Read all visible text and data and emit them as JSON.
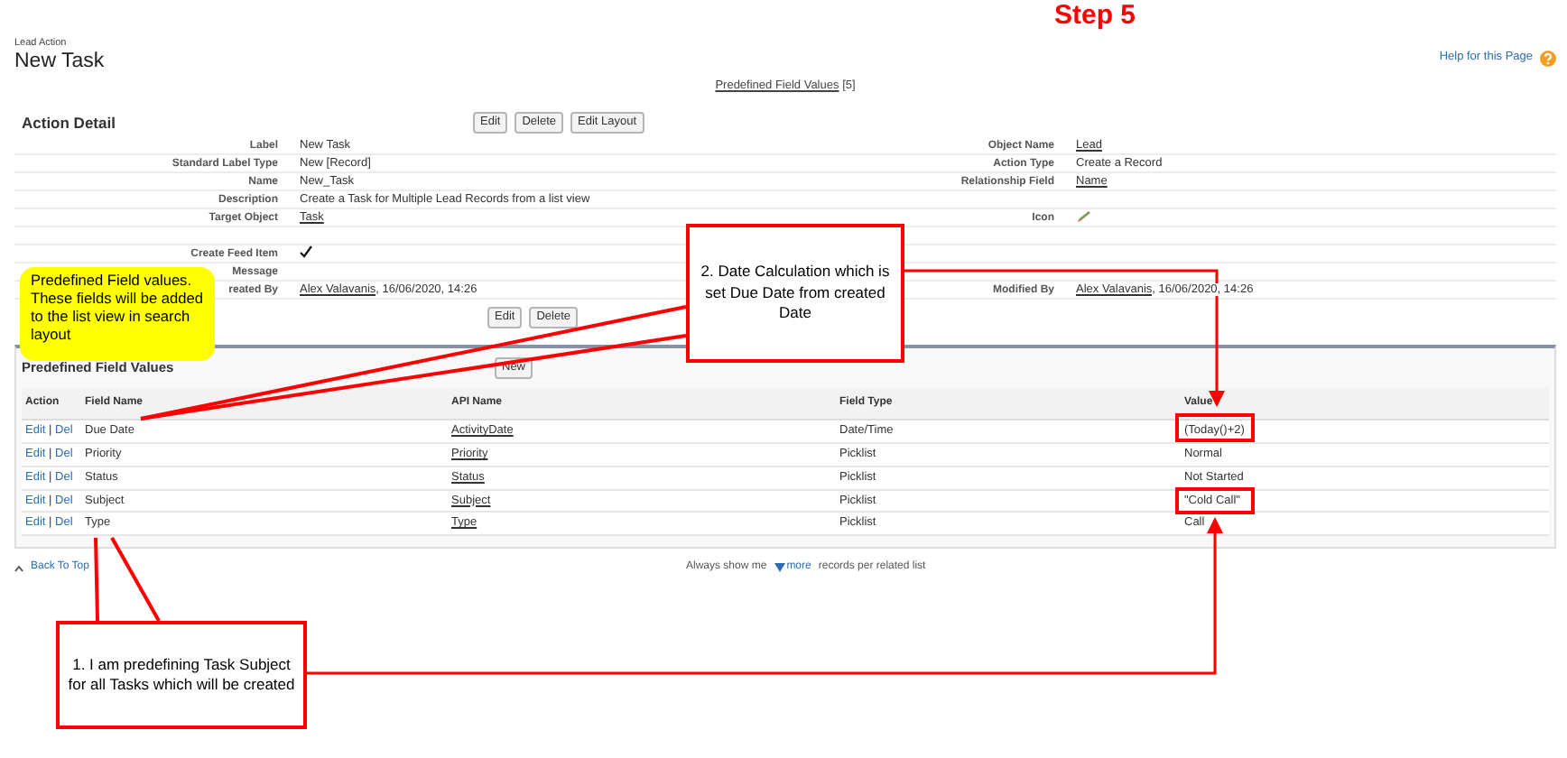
{
  "step_title": "Step 5",
  "header": {
    "breadcrumb": "Lead Action",
    "title": "New Task",
    "help_link": "Help for this Page"
  },
  "related_links": [
    {
      "label": "Predefined Field Values",
      "count": "[5]"
    }
  ],
  "action_detail": {
    "title": "Action Detail",
    "buttons": [
      "Edit",
      "Delete",
      "Edit Layout"
    ],
    "rows": [
      {
        "left": {
          "label": "Label",
          "kind": "text",
          "value": "New Task"
        },
        "right": {
          "label": "Object Name",
          "kind": "link",
          "value": "Lead"
        }
      },
      {
        "left": {
          "label": "Standard Label Type",
          "kind": "text",
          "value": "New [Record]"
        },
        "right": {
          "label": "Action Type",
          "kind": "text",
          "value": "Create a Record"
        }
      },
      {
        "left": {
          "label": "Name",
          "kind": "text",
          "value": "New_Task"
        },
        "right": {
          "label": "Relationship Field",
          "kind": "link",
          "value": "Name"
        }
      },
      {
        "left": {
          "label": "Description",
          "kind": "text",
          "value": "Create a Task for Multiple Lead Records from a list view"
        }
      },
      {
        "left": {
          "label": "Target Object",
          "kind": "link",
          "value": "Task"
        },
        "right": {
          "label": "Icon",
          "kind": "icon"
        }
      },
      {},
      {
        "left": {
          "label": "Create Feed Item",
          "kind": "check",
          "checked": true
        }
      },
      {
        "left": {
          "label": "Message",
          "kind": "text"
        }
      },
      {
        "left": {
          "label": "reated By",
          "kind": "user",
          "value": "Alex Valavanis",
          "date": ", 16/06/2020, 14:26"
        },
        "right": {
          "label": "Modified By",
          "kind": "user",
          "value": "Alex Valavanis",
          "date": ", 16/06/2020, 14:26"
        }
      }
    ],
    "bottom_buttons": [
      "Edit",
      "Delete"
    ]
  },
  "related_list": {
    "title": "Predefined Field Values",
    "button": "New",
    "columns": [
      "Action",
      "Field Name",
      "API Name",
      "Field Type",
      "Value"
    ],
    "action_separator": "|",
    "rows": [
      {
        "actions": [
          "Edit",
          "Del"
        ],
        "field_name": "Due Date",
        "api_name": "ActivityDate",
        "field_type": "Date/Time",
        "value": "(Today()+2)"
      },
      {
        "actions": [
          "Edit",
          "Del"
        ],
        "field_name": "Priority",
        "api_name": "Priority",
        "field_type": "Picklist",
        "value": "Normal"
      },
      {
        "actions": [
          "Edit",
          "Del"
        ],
        "field_name": "Status",
        "api_name": "Status",
        "field_type": "Picklist",
        "value": "Not Started"
      },
      {
        "actions": [
          "Edit",
          "Del"
        ],
        "field_name": "Subject",
        "api_name": "Subject",
        "field_type": "Picklist",
        "value": "\"Cold Call\""
      },
      {
        "actions": [
          "Edit",
          "Del"
        ],
        "field_name": "Type",
        "api_name": "Type",
        "field_type": "Picklist",
        "value": "Call"
      }
    ]
  },
  "footer": {
    "back_to_top": "Back To Top",
    "show_prefix": "Always show me",
    "more": "more",
    "show_suffix": "records per related list"
  },
  "annotations": {
    "note": "Predefined Field values. These fields will be added to the list view in search layout",
    "callout_date": "2. Date Calculation which is set Due Date from created Date",
    "callout_subject": "1. I am predefining Task Subject for all Tasks which will be created"
  }
}
